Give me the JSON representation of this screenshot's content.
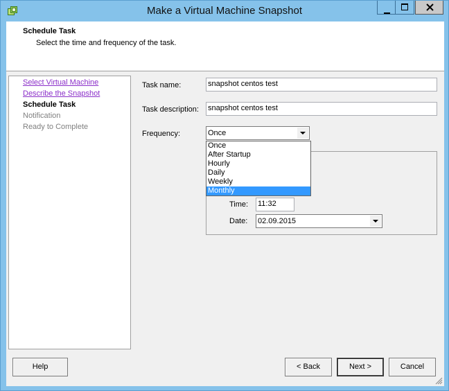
{
  "window": {
    "title": "Make a Virtual Machine Snapshot",
    "app_icon": "vsphere-icon",
    "controls": [
      "minimize-icon",
      "maximize-icon",
      "close-icon"
    ]
  },
  "header": {
    "title": "Schedule Task",
    "subtitle": "Select the time and frequency of the task."
  },
  "steps": [
    {
      "label": "Select Virtual Machine",
      "state": "link"
    },
    {
      "label": "Describe the Snapshot",
      "state": "link"
    },
    {
      "label": "Schedule Task",
      "state": "current"
    },
    {
      "label": "Notification",
      "state": "pending"
    },
    {
      "label": "Ready to Complete",
      "state": "pending"
    }
  ],
  "form": {
    "task_name_label": "Task name:",
    "task_name_value": "snapshot centos test",
    "task_description_label": "Task description:",
    "task_description_value": "snapshot centos test",
    "frequency_label": "Frequency:",
    "frequency_value": "Once",
    "frequency_options": [
      "Once",
      "After Startup",
      "Hourly",
      "Daily",
      "Weekly",
      "Monthly"
    ],
    "frequency_highlighted": "Monthly",
    "time_label": "Time:",
    "time_value": "11:32",
    "date_label": "Date:",
    "date_value": "02.09.2015"
  },
  "buttons": {
    "help": "Help",
    "back": "< Back",
    "next": "Next >",
    "cancel": "Cancel"
  },
  "colors": {
    "titlebar": "#85c2ea",
    "link": "#8b2fc9",
    "selection": "#3399ff"
  }
}
